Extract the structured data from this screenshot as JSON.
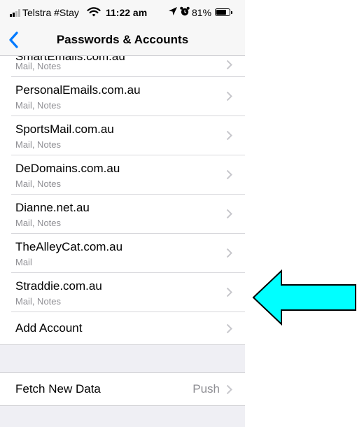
{
  "status_bar": {
    "carrier": "Telstra #Stay",
    "time": "11:22 am",
    "battery_percent": "81%",
    "battery_level": 0.81,
    "icons": [
      "signal-icon",
      "wifi-icon",
      "location-icon",
      "alarm-icon",
      "battery-icon"
    ]
  },
  "nav": {
    "back_icon": "chevron-left-icon",
    "title": "Passwords & Accounts"
  },
  "accounts": [
    {
      "name": "SmartEmails.com.au",
      "services": "Mail, Notes"
    },
    {
      "name": "PersonalEmails.com.au",
      "services": "Mail, Notes"
    },
    {
      "name": "SportsMail.com.au",
      "services": "Mail, Notes"
    },
    {
      "name": "DeDomains.com.au",
      "services": "Mail, Notes"
    },
    {
      "name": "Dianne.net.au",
      "services": "Mail, Notes"
    },
    {
      "name": "TheAlleyCat.com.au",
      "services": "Mail"
    },
    {
      "name": "Straddie.com.au",
      "services": "Mail, Notes"
    }
  ],
  "add_account_label": "Add Account",
  "fetch": {
    "label": "Fetch New Data",
    "value": "Push"
  },
  "colors": {
    "accent": "#007aff",
    "group_background": "#efeff4",
    "secondary_text": "#8e8e93",
    "annotation_arrow": "#00ffff"
  }
}
